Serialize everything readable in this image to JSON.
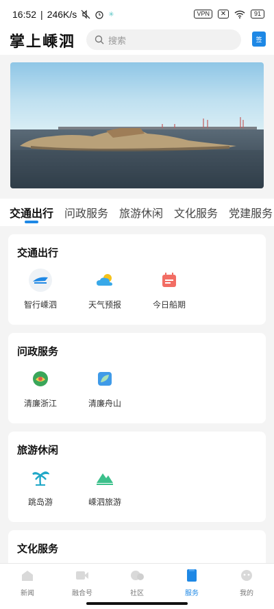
{
  "status": {
    "time": "16:52",
    "speed": "246K/s",
    "vpn": "VPN",
    "battery": "91"
  },
  "header": {
    "logo": "掌上嵊泗",
    "search_placeholder": "搜索",
    "sign_label": "签"
  },
  "tabs": [
    "交通出行",
    "问政服务",
    "旅游休闲",
    "文化服务",
    "党建服务"
  ],
  "sections": [
    {
      "title": "交通出行",
      "items": [
        {
          "label": "智行嵊泗",
          "icon": "ship-logo-icon"
        },
        {
          "label": "天气预报",
          "icon": "weather-icon"
        },
        {
          "label": "今日船期",
          "icon": "calendar-icon"
        }
      ]
    },
    {
      "title": "问政服务",
      "items": [
        {
          "label": "清廉浙江",
          "icon": "green-emblem-icon"
        },
        {
          "label": "清廉舟山",
          "icon": "leaf-icon"
        }
      ]
    },
    {
      "title": "旅游休闲",
      "items": [
        {
          "label": "跳岛游",
          "icon": "palm-tree-icon"
        },
        {
          "label": "嵊泗旅游",
          "icon": "mountain-icon"
        }
      ]
    },
    {
      "title": "文化服务",
      "items": []
    }
  ],
  "nav": [
    {
      "label": "新闻",
      "icon": "news-icon"
    },
    {
      "label": "融合号",
      "icon": "video-icon"
    },
    {
      "label": "社区",
      "icon": "community-icon"
    },
    {
      "label": "服务",
      "icon": "service-icon"
    },
    {
      "label": "我的",
      "icon": "profile-icon"
    }
  ],
  "colors": {
    "accent": "#1e88e5"
  }
}
